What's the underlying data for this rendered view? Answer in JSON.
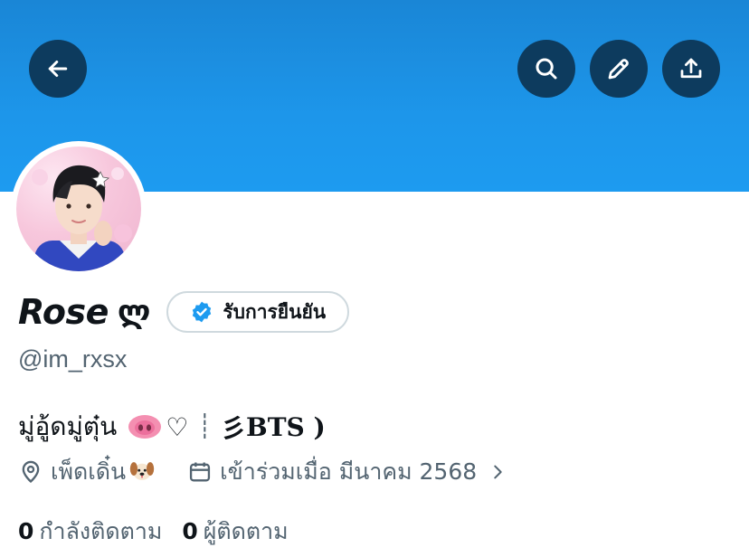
{
  "profile": {
    "display_name": "Rose",
    "name_decoration": "ლ",
    "verify_label": "รับการยืนยัน",
    "handle": "@im_rxsx",
    "bio": {
      "text_start": "มู่อู้ดมู่ตุ๋น",
      "heart": "♡",
      "separator": "┊",
      "tail_symbol": "彡",
      "tail_text": "BTS )"
    },
    "location": "เพ็ดเดิ๋น",
    "joined": "เข้าร่วมเมื่อ มีนาคม 2568"
  },
  "stats": {
    "following_count": "0",
    "following_label": "กำลังติดตาม",
    "followers_count": "0",
    "followers_label": "ผู้ติดตาม"
  },
  "icons": {
    "back": "arrow-left-icon",
    "search": "search-icon",
    "edit": "pencil-icon",
    "share": "share-icon",
    "verified": "verified-badge-icon",
    "location": "location-pin-icon",
    "calendar": "calendar-icon"
  },
  "colors": {
    "banner": "#1d9bf0",
    "button_bg": "#0d3b5e",
    "verified": "#1d9bf0",
    "secondary_text": "#536471"
  }
}
